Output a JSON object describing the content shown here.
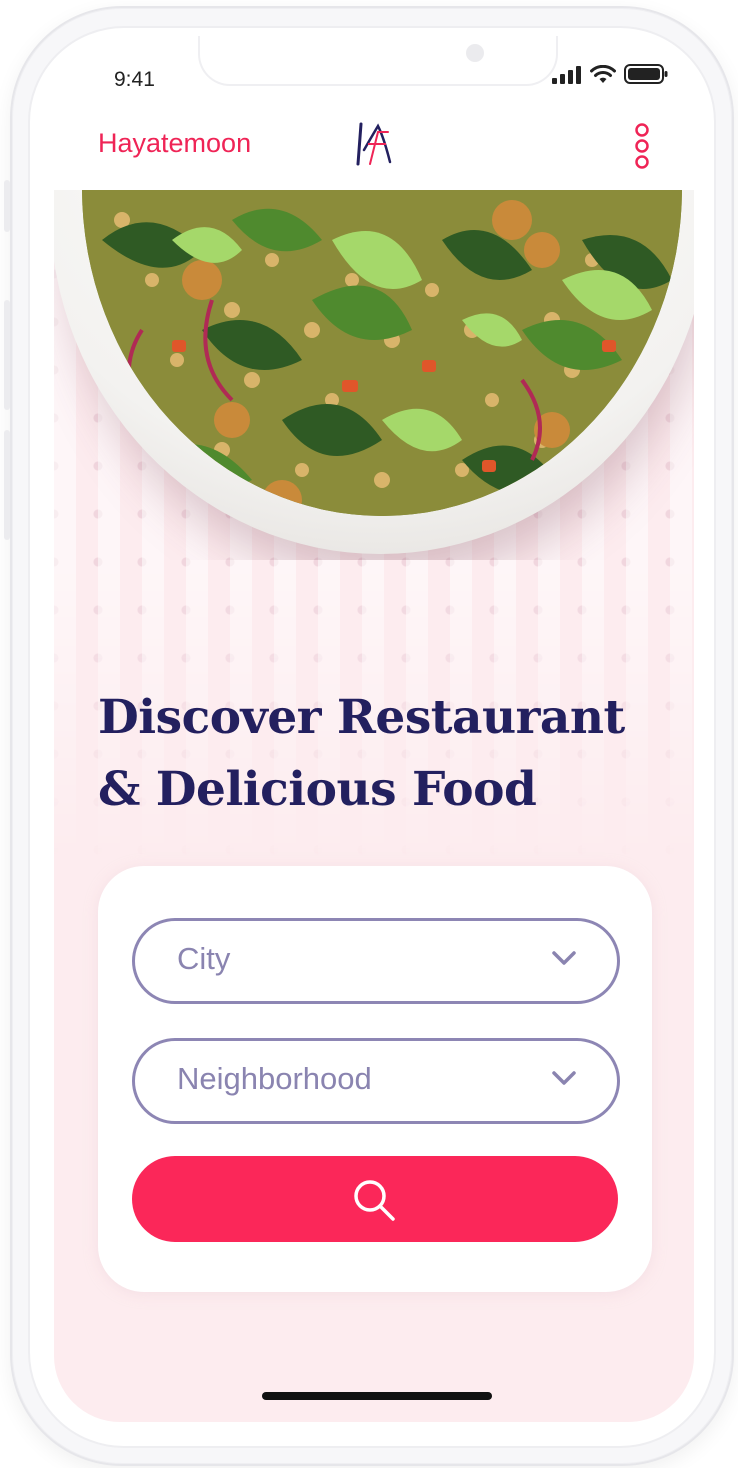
{
  "status_bar": {
    "time": "9:41"
  },
  "header": {
    "brand_name": "Hayatemoon",
    "logo_alt": "Hayatemoon logo",
    "menu_icon": "more-vertical-icon"
  },
  "hero": {
    "image_alt": "Salad bowl",
    "headline_line1": "Discover Restaurant",
    "headline_line2": "& Delicious Food"
  },
  "search_form": {
    "city_select": {
      "value": "City",
      "icon": "chevron-down-icon"
    },
    "neighborhood_select": {
      "value": "Neighborhood",
      "icon": "chevron-down-icon"
    },
    "search_button": {
      "icon": "search-icon"
    }
  },
  "colors": {
    "brand": "#ef2456",
    "button": "#fb2759",
    "headline": "#23205f",
    "select_border": "#8d86b4",
    "background": "#fdecef"
  }
}
